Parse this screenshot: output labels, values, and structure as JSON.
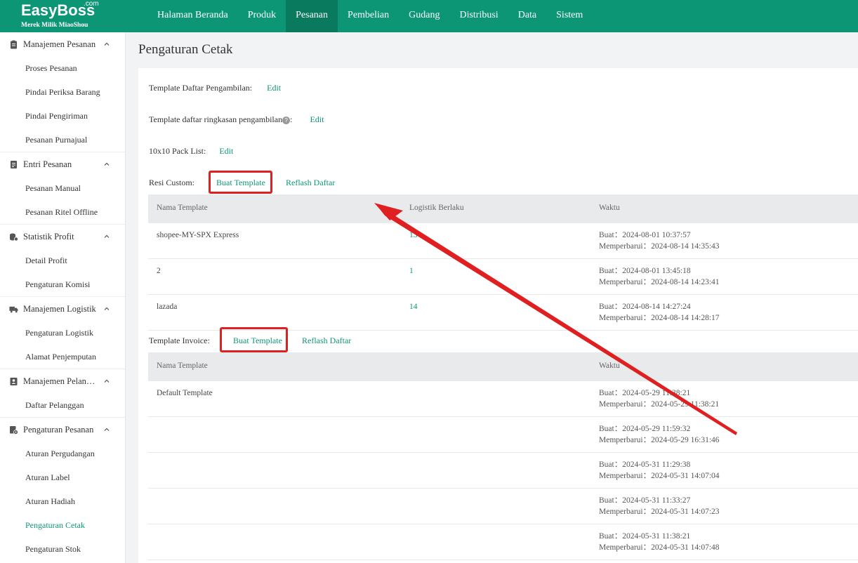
{
  "brand": {
    "name": "EasyBoss",
    "suffix": ".com",
    "tagline": "Merek Milik MiaoShou"
  },
  "nav": [
    {
      "label": "Halaman Beranda",
      "active": false
    },
    {
      "label": "Produk",
      "active": false
    },
    {
      "label": "Pesanan",
      "active": true
    },
    {
      "label": "Pembelian",
      "active": false
    },
    {
      "label": "Gudang",
      "active": false
    },
    {
      "label": "Distribusi",
      "active": false
    },
    {
      "label": "Data",
      "active": false
    },
    {
      "label": "Sistem",
      "active": false
    }
  ],
  "sidebar": {
    "groups": [
      {
        "label": "Manajemen Pesanan",
        "icon": "clipboard-icon",
        "items": [
          "Proses Pesanan",
          "Pindai Periksa Barang",
          "Pindai Pengiriman",
          "Pesanan Purnajual"
        ]
      },
      {
        "label": "Entri Pesanan",
        "icon": "document-icon",
        "items": [
          "Pesanan Manual",
          "Pesanan Ritel Offline"
        ]
      },
      {
        "label": "Statistik Profit",
        "icon": "coins-icon",
        "items": [
          "Detail Profit",
          "Pengaturan Komisi"
        ]
      },
      {
        "label": "Manajemen Logistik",
        "icon": "truck-icon",
        "items": [
          "Pengaturan Logistik",
          "Alamat Penjemputan"
        ]
      },
      {
        "label": "Manajemen Pelan…",
        "icon": "contact-card-icon",
        "items": [
          "Daftar Pelanggan"
        ]
      },
      {
        "label": "Pengaturan Pesanan",
        "icon": "settings-doc-icon",
        "items": [
          "Aturan Pergudangan",
          "Aturan Label",
          "Aturan Hadiah",
          "Pengaturan Cetak",
          "Pengaturan Stok"
        ]
      }
    ],
    "active_item": "Pengaturan Cetak"
  },
  "page": {
    "title": "Pengaturan Cetak",
    "picking_template": {
      "label": "Template Daftar Pengambilan:",
      "action": "Edit"
    },
    "picking_summary_template": {
      "label": "Template daftar ringkasan pengambilan",
      "help": "?",
      "colon": ":",
      "action": "Edit"
    },
    "pack_list": {
      "label": "10x10 Pack List:",
      "action": "Edit"
    },
    "custom_receipt": {
      "label": "Resi Custom:",
      "create": "Buat Template",
      "refresh": "Reflash Daftar",
      "columns": [
        "Nama Template",
        "Logistik Berlaku",
        "Waktu"
      ],
      "rows": [
        {
          "name": "shopee-MY-SPX Express",
          "logistics": "13",
          "created": "Buat：2024-08-01 10:37:57",
          "updated": "Memperbarui：2024-08-14 14:35:43"
        },
        {
          "name": "2",
          "logistics": "1",
          "created": "Buat：2024-08-01 13:45:18",
          "updated": "Memperbarui：2024-08-14 14:23:41"
        },
        {
          "name": "lazada",
          "logistics": "14",
          "created": "Buat：2024-08-14 14:27:24",
          "updated": "Memperbarui：2024-08-14 14:28:17"
        }
      ]
    },
    "invoice_template": {
      "label": "Template Invoice:",
      "create": "Buat Template",
      "refresh": "Reflash Daftar",
      "columns": [
        "Nama Template",
        "Waktu"
      ],
      "rows": [
        {
          "name": "Default Template",
          "created": "Buat：2024-05-29 11:38:21",
          "updated": "Memperbarui：2024-05-29 11:38:21"
        },
        {
          "name": "",
          "created": "Buat：2024-05-29 11:59:32",
          "updated": "Memperbarui：2024-05-29 16:31:46"
        },
        {
          "name": "",
          "created": "Buat：2024-05-31 11:29:38",
          "updated": "Memperbarui：2024-05-31 14:07:04"
        },
        {
          "name": "",
          "created": "Buat：2024-05-31 11:33:27",
          "updated": "Memperbarui：2024-05-31 14:07:23"
        },
        {
          "name": "",
          "created": "Buat：2024-05-31 11:38:21",
          "updated": "Memperbarui：2024-05-31 14:07:48"
        }
      ]
    }
  },
  "colors": {
    "brand": "#0d9676",
    "nav_active": "#0a7a5f",
    "highlight": "#e02020",
    "table_header": "#e9eaec"
  }
}
